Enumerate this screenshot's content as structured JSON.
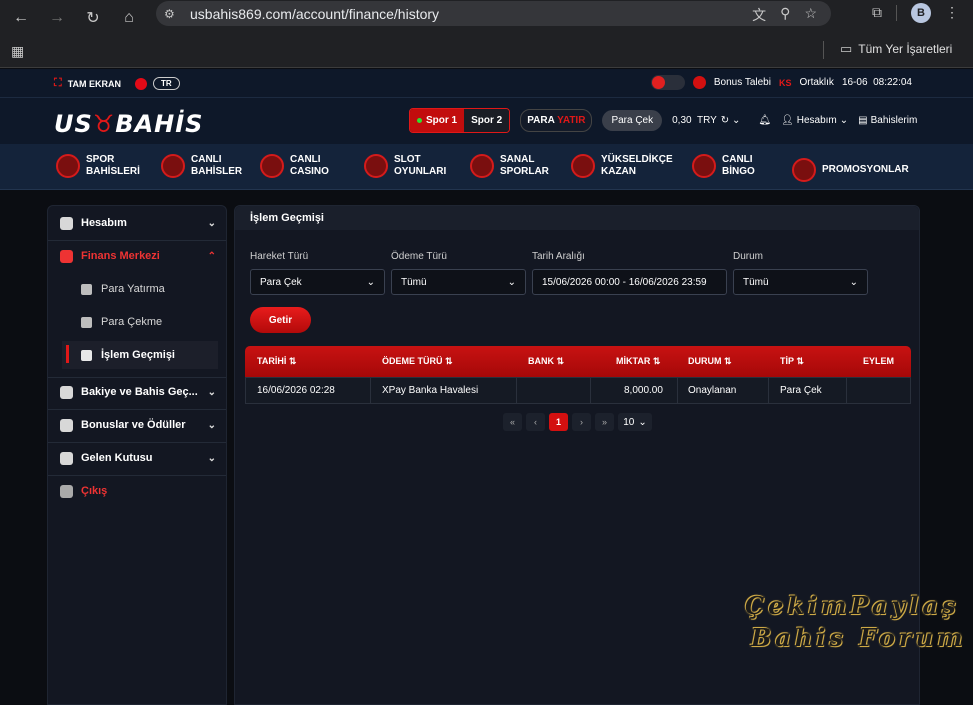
{
  "browser": {
    "url": "usbahis869.com/account/finance/history",
    "profile_initial": "B",
    "bookmarks_folder": "Tüm Yer İşaretleri"
  },
  "topbar": {
    "fullscreen": "TAM EKRAN",
    "lang": "TR",
    "bonus": "Bonus Talebi",
    "partner": "Ortaklık",
    "datetime": "16-06  08:22:04"
  },
  "header": {
    "logo_left": "US",
    "logo_right": "BAHİS",
    "sport1": "Spor 1",
    "sport2": "Spor 2",
    "deposit_a": "PARA",
    "deposit_b": "YATIR",
    "withdraw": "Para Çek",
    "balance": "0,30  TRY",
    "account": "Hesabım",
    "bets": "Bahislerim"
  },
  "nav": [
    {
      "l1": "SPOR",
      "l2": "BAHİSLERİ"
    },
    {
      "l1": "CANLI",
      "l2": "BAHİSLER"
    },
    {
      "l1": "CANLI",
      "l2": "CASINO"
    },
    {
      "l1": "SLOT",
      "l2": "OYUNLARI"
    },
    {
      "l1": "SANAL",
      "l2": "SPORLAR"
    },
    {
      "l1": "YÜKSELDİKÇE",
      "l2": "KAZAN"
    },
    {
      "l1": "CANLI",
      "l2": "BİNGO"
    },
    {
      "l1": "PROMOSYONLAR",
      "l2": ""
    }
  ],
  "sidebar": {
    "account": "Hesabım",
    "finance": "Finans Merkezi",
    "deposit": "Para Yatırma",
    "withdraw": "Para Çekme",
    "history": "İşlem Geçmişi",
    "balance": "Bakiye ve Bahis Geç...",
    "bonuses": "Bonuslar ve Ödüller",
    "inbox": "Gelen Kutusu",
    "logout": "Çıkış"
  },
  "content": {
    "title": "İşlem Geçmişi",
    "filters": {
      "type_label": "Hareket Türü",
      "type_value": "Para Çek",
      "payment_label": "Ödeme Türü",
      "payment_value": "Tümü",
      "date_label": "Tarih Aralığı",
      "date_value": "15/06/2026 00:00 - 16/06/2026 23:59",
      "status_label": "Durum",
      "status_value": "Tümü"
    },
    "submit": "Getir",
    "table": {
      "headers": [
        "TARİHİ",
        "ÖDEME TÜRÜ",
        "BANK",
        "MİKTAR",
        "DURUM",
        "TİP",
        "EYLEM"
      ],
      "rows": [
        [
          "16/06/2026 02:28",
          "XPay Banka Havalesi",
          "",
          "8,000.00",
          "Onaylanan",
          "Para Çek",
          ""
        ]
      ]
    },
    "pagination": {
      "current": "1",
      "page_size": "10"
    }
  },
  "watermark": {
    "line1": "ÇekimPaylaş",
    "line2": "Bahis Forum"
  }
}
